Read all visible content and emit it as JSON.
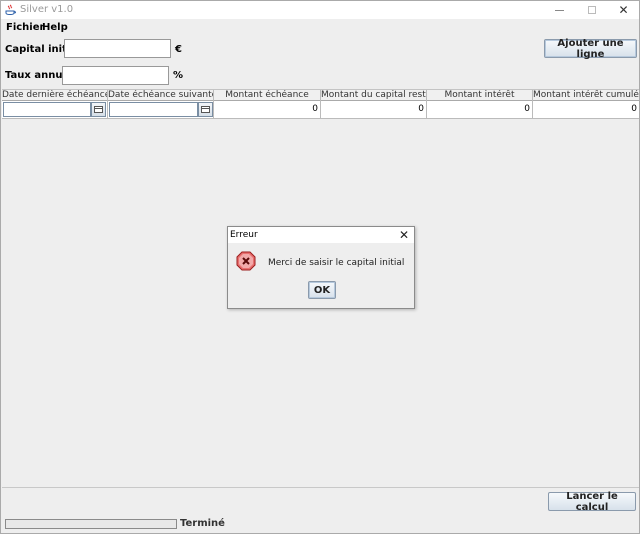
{
  "window": {
    "title": "Silver v1.0",
    "controls": {
      "minimize": "",
      "maximize": "",
      "close": "✕"
    }
  },
  "menu": {
    "items": [
      "Fichier",
      "Help"
    ]
  },
  "form": {
    "capital_label": "Capital initial :",
    "capital_value": "",
    "capital_unit": "€",
    "taux_label": "Taux annuel :",
    "taux_value": "",
    "taux_unit": "%",
    "add_row_button": "Ajouter une ligne"
  },
  "table": {
    "columns": [
      "Date dernière échéance",
      "Date échéance suivante",
      "Montant échéance",
      "Montant du capital restan...",
      "Montant intérêt",
      "Montant intérêt cumulé"
    ],
    "rows": [
      {
        "date_derniere": "",
        "date_suivante": "",
        "montant_echeance": "0",
        "capital_restant": "0",
        "interet": "0",
        "interet_cumule": "0"
      }
    ]
  },
  "actions": {
    "run_button": "Lancer le calcul"
  },
  "status": {
    "progress": 0,
    "text": "Terminé"
  },
  "dialog": {
    "title": "Erreur",
    "close": "✕",
    "message": "Merci de saisir le capital initial",
    "ok": "OK",
    "icon": "error-icon"
  }
}
